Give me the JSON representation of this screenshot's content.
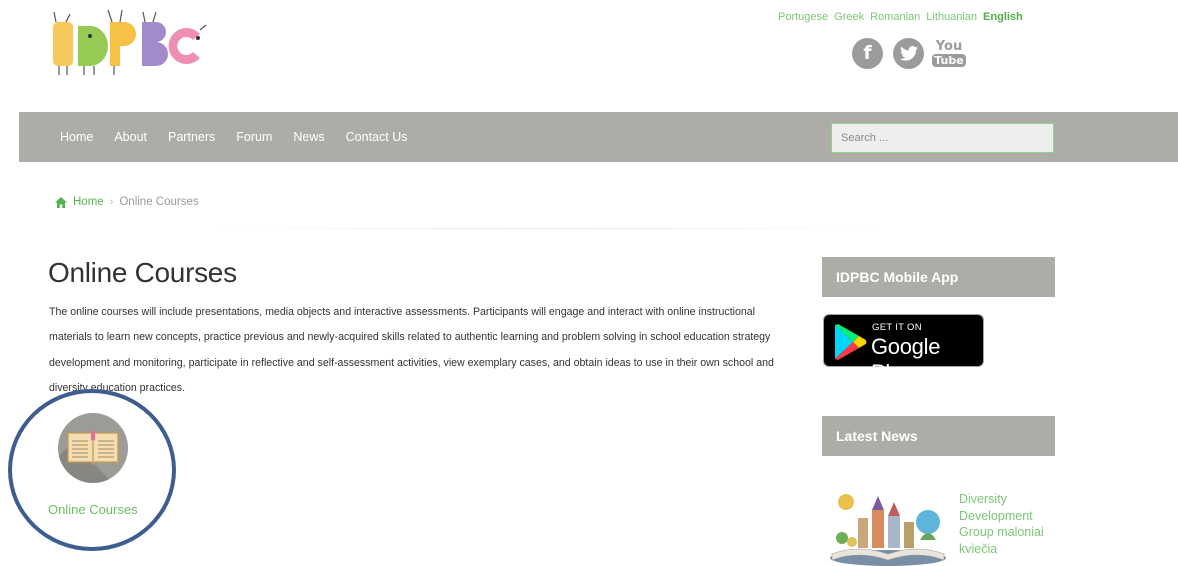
{
  "header": {
    "logo_text": "IDPBC",
    "languages": [
      "Portugese",
      "Greek",
      "Romanian",
      "Lithuanian",
      "English"
    ],
    "active_language": "English",
    "social": [
      {
        "name": "facebook-icon",
        "glyph": "f"
      },
      {
        "name": "twitter-icon"
      },
      {
        "name": "youtube-icon",
        "top": "You",
        "bottom": "Tube"
      }
    ]
  },
  "nav": {
    "items": [
      "Home",
      "About",
      "Partners",
      "Forum",
      "News",
      "Contact Us"
    ],
    "search_placeholder": "Search ..."
  },
  "breadcrumb": {
    "home": "Home",
    "separator": "›",
    "current": "Online Courses"
  },
  "main": {
    "title": "Online Courses",
    "description": "The online courses will include presentations, media objects and interactive assessments. Participants will engage and interact with online instructional materials to learn new concepts, practice previous and newly-acquired skills related to authentic learning and problem solving in school education strategy development and monitoring, participate in reflective and self-assessment activities, view exemplary cases, and obtain ideas to use in their own school and diversity education practices.",
    "course_label": "Online Courses"
  },
  "sidebar": {
    "app_heading": "IDPBC Mobile App",
    "google_play": {
      "line1": "GET IT ON",
      "line2": "Google Play"
    },
    "news_heading": "Latest News",
    "news_item": "Diversity Development Group maloniai kviečia"
  },
  "colors": {
    "accent_green": "#7cc576",
    "nav_gray": "#aeaca6",
    "annotation_blue": "#3d5d8e"
  }
}
